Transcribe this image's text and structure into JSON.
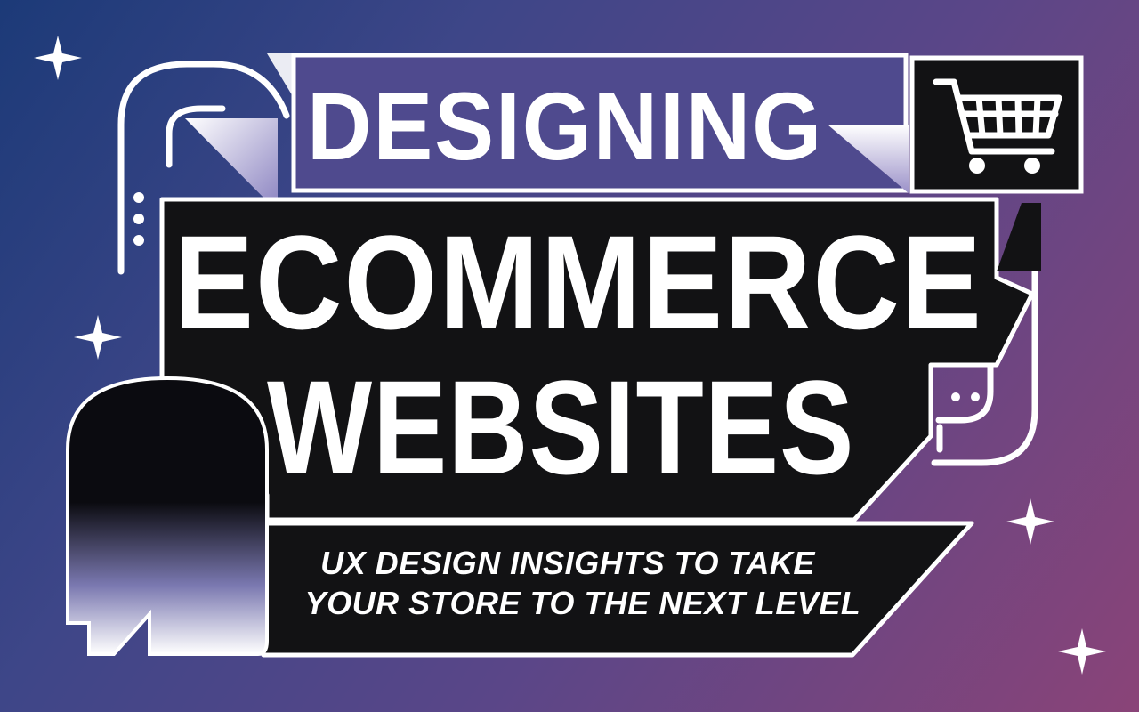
{
  "banner": {
    "line1": "DESIGNING",
    "line2": "ECOMMERCE",
    "line3": "WEBSITES",
    "subtitle_line1": "UX DESIGN INSIGHTS TO TAKE",
    "subtitle_line2": "YOUR STORE TO THE NEXT LEVEL"
  },
  "icons": [
    "shopping-cart-icon",
    "sparkle-icon",
    "dots-icon",
    "pipe-decoration",
    "arch-silhouette"
  ],
  "colors": {
    "bg_start": "#1c3a78",
    "bg_end": "#8a4478",
    "panel": "#121214",
    "accent_purple": "#5a4a90",
    "text": "#ffffff"
  }
}
